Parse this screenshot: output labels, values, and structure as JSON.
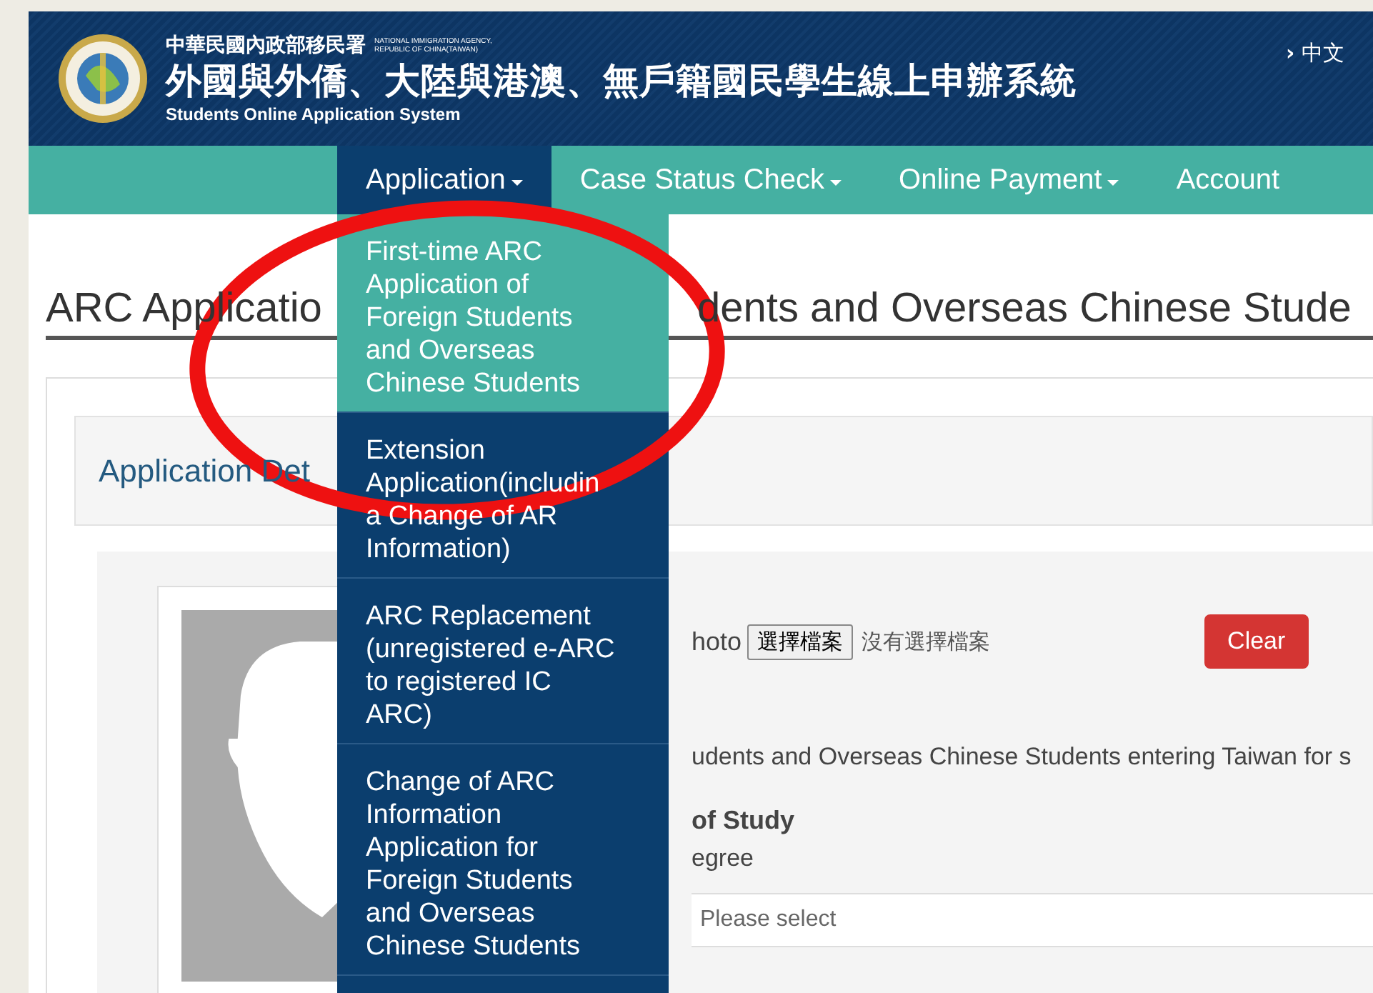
{
  "header": {
    "agency_zh": "中華民國內政部移民署",
    "agency_en": [
      "NATIONAL IMMIGRATION AGENCY,",
      "REPUBLIC OF CHINA(TAIWAN)"
    ],
    "title": "外國與外僑、大陸與港澳、無戶籍國民學生線上申辦系統",
    "subtitle": "Students Online Application System",
    "language_arrow": "›",
    "language_link": "中文"
  },
  "nav": [
    {
      "label": "Application",
      "selected": true,
      "caret": true
    },
    {
      "label": "Case Status Check",
      "selected": false,
      "caret": true
    },
    {
      "label": "Online Payment",
      "selected": false,
      "caret": true
    },
    {
      "label": "Account",
      "selected": false,
      "caret": false
    }
  ],
  "dropdown": [
    {
      "label": "First-time ARC\nApplication of\nForeign Students\nand Overseas\nChinese Students",
      "selected": true
    },
    {
      "label": "Extension\nApplication(includin\na Change of AR\nInformation)",
      "selected": false
    },
    {
      "label": "ARC Replacement\n(unregistered e-ARC\nto registered IC\nARC)",
      "selected": false
    },
    {
      "label": "Change of ARC\nInformation\nApplication for\nForeign Students\nand Overseas\nChinese Students",
      "selected": false
    }
  ],
  "heading_fragments": [
    "ARC Applicatio",
    "dents and Overseas Chinese Stude"
  ],
  "panel": {
    "title": "Application Det"
  },
  "form": {
    "photo_label": "hoto",
    "file_button": "選擇檔案",
    "file_status": "沒有選擇檔案",
    "clear_button": "Clear",
    "notice": "udents and Overseas Chinese Students entering Taiwan for s",
    "study_label": "of Study",
    "study_value": "egree",
    "select": {
      "placeholder": "Please select"
    }
  },
  "annotations": [
    {
      "kind": "ellipse"
    }
  ]
}
